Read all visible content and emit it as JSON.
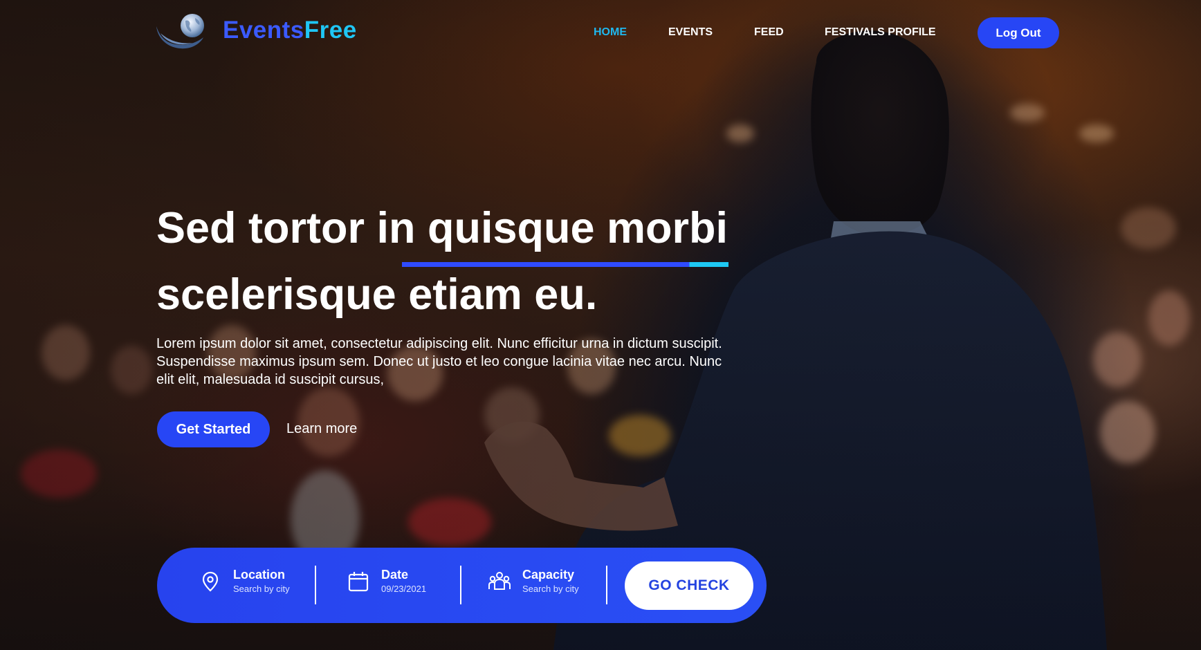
{
  "brand": {
    "part1": "Events",
    "part2": "Free",
    "color1": "#3b5bff",
    "color2": "#1fc6f5"
  },
  "nav": {
    "items": [
      {
        "label": "HOME",
        "active": true
      },
      {
        "label": "EVENTS",
        "active": false
      },
      {
        "label": "FEED",
        "active": false
      },
      {
        "label": "FESTIVALS PROFILE",
        "active": false
      }
    ],
    "logout_label": "Log Out"
  },
  "hero": {
    "title_line1": "Sed tortor in quisque morbi",
    "title_line2": "scelerisque etiam eu.",
    "description": "Lorem ipsum dolor sit amet, consectetur adipiscing elit. Nunc efficitur urna in dictum suscipit. Suspendisse maximus ipsum sem. Donec ut justo et leo congue lacinia vitae nec arcu. Nunc elit elit, malesuada id suscipit cursus,",
    "primary_button": "Get Started",
    "secondary_link": "Learn more"
  },
  "search": {
    "location": {
      "label": "Location",
      "value": "Search by city",
      "icon": "map-pin-icon"
    },
    "date": {
      "label": "Date",
      "value": "09/23/2021",
      "icon": "calendar-icon"
    },
    "capacity": {
      "label": "Capacity",
      "value": "Search by city",
      "icon": "people-icon"
    },
    "submit_label": "GO CHECK"
  },
  "colors": {
    "accent": "#2746f5",
    "accent_light": "#1fb8ef"
  }
}
